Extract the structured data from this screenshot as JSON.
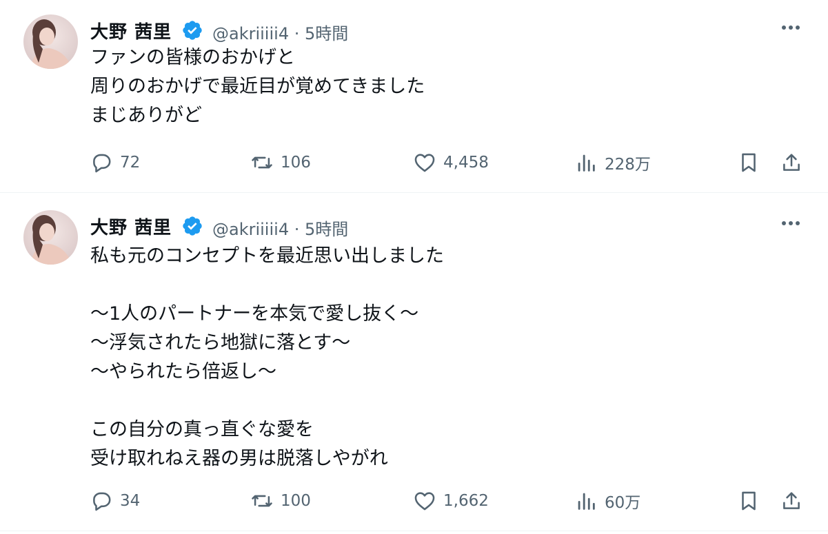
{
  "tweets": [
    {
      "author_name": "大野 茜里",
      "handle": "@akriiiii4",
      "separator": "·",
      "time": "5時間",
      "text": "ファンの皆様のおかげと\n周りのおかげで最近目が覚めてきました\nまじありがど",
      "replies": "72",
      "retweets": "106",
      "likes": "4,458",
      "views": "228万"
    },
    {
      "author_name": "大野 茜里",
      "handle": "@akriiiii4",
      "separator": "·",
      "time": "5時間",
      "text": "私も元のコンセプトを最近思い出しました\n\n〜1人のパートナーを本気で愛し抜く〜\n〜浮気されたら地獄に落とす〜\n〜やられたら倍返し〜\n\nこの自分の真っ直ぐな愛を\n受け取れねえ器の男は脱落しやがれ",
      "replies": "34",
      "retweets": "100",
      "likes": "1,662",
      "views": "60万"
    }
  ],
  "colors": {
    "text_primary": "#0f1419",
    "text_secondary": "#536471",
    "verified": "#1d9bf0",
    "divider": "#eff3f4"
  },
  "icons": [
    "avatar",
    "verified-badge-icon",
    "more-icon",
    "reply-icon",
    "retweet-icon",
    "like-icon",
    "views-icon",
    "bookmark-icon",
    "share-icon"
  ]
}
